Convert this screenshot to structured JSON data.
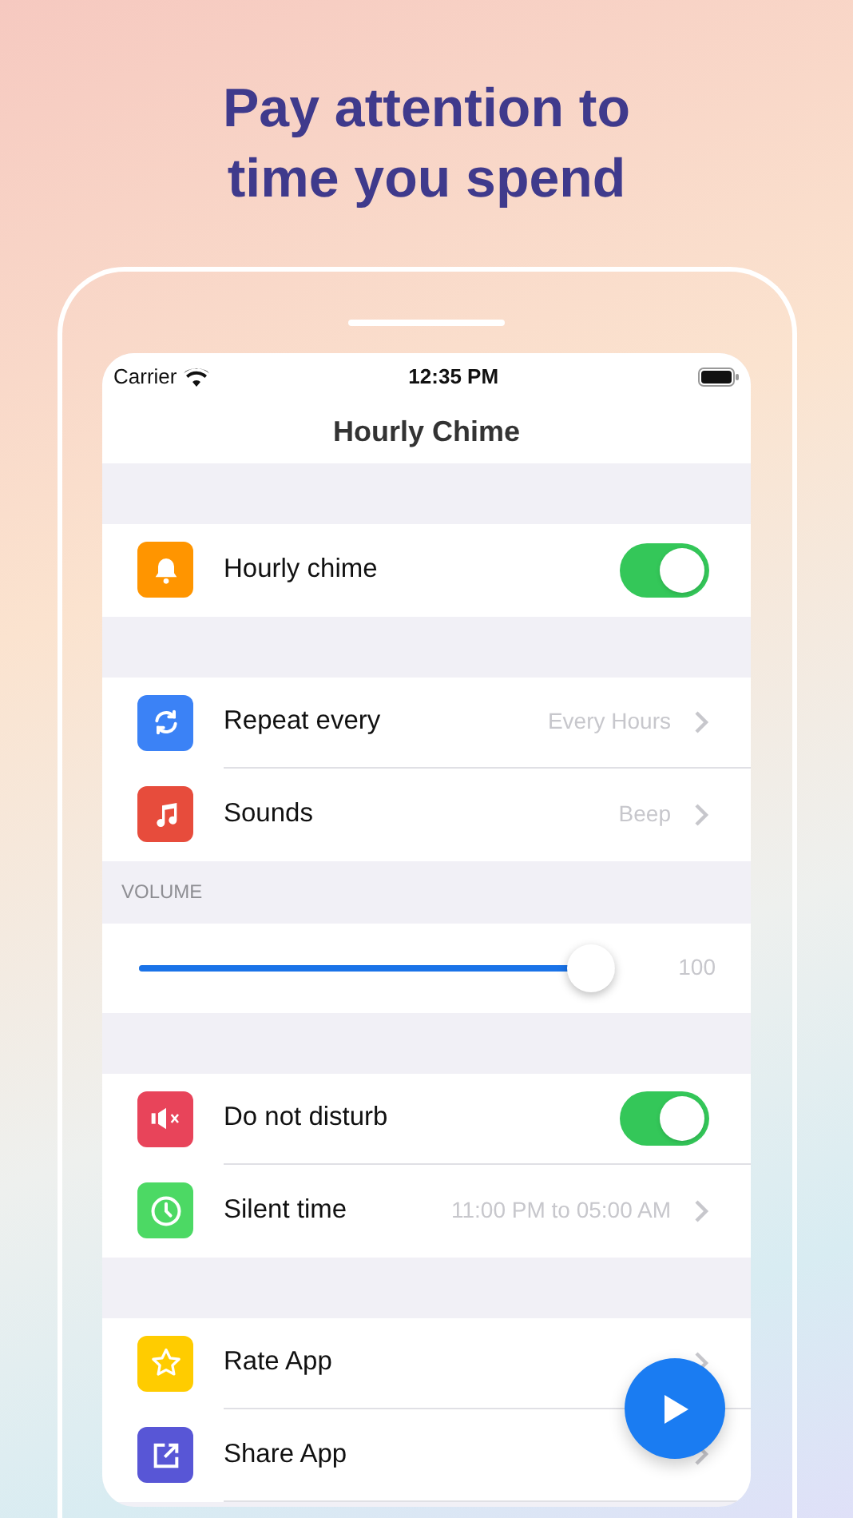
{
  "headline": [
    "Pay attention to",
    "time you spend"
  ],
  "status_bar": {
    "carrier": "Carrier",
    "time": "12:35 PM"
  },
  "nav_title": "Hourly Chime",
  "sections": [
    {
      "rows": [
        {
          "kind": "toggle",
          "label": "Hourly chime",
          "color": "#ff9500",
          "on": true
        }
      ]
    },
    {
      "rows": [
        {
          "kind": "link",
          "label": "Repeat every",
          "value": "Every Hours",
          "color": "#3b82f6"
        },
        {
          "kind": "link",
          "label": "Sounds",
          "value": "Beep",
          "color": "#e74c3c"
        }
      ]
    },
    {
      "header": "VOLUME",
      "rows": [
        {
          "kind": "slider",
          "level": 1,
          "reading": "100"
        }
      ]
    },
    {
      "rows": [
        {
          "kind": "toggle",
          "label": "Do not disturb",
          "color": "#e8445a",
          "on": true
        },
        {
          "kind": "link",
          "label": "Silent time",
          "value": "11:00 PM to 05:00 AM",
          "color": "#4cd964"
        }
      ]
    },
    {
      "rows": [
        {
          "kind": "link",
          "label": "Rate App",
          "color": "#ffcc00"
        },
        {
          "kind": "link",
          "label": "Share App",
          "color": "#5856d6"
        }
      ]
    }
  ]
}
